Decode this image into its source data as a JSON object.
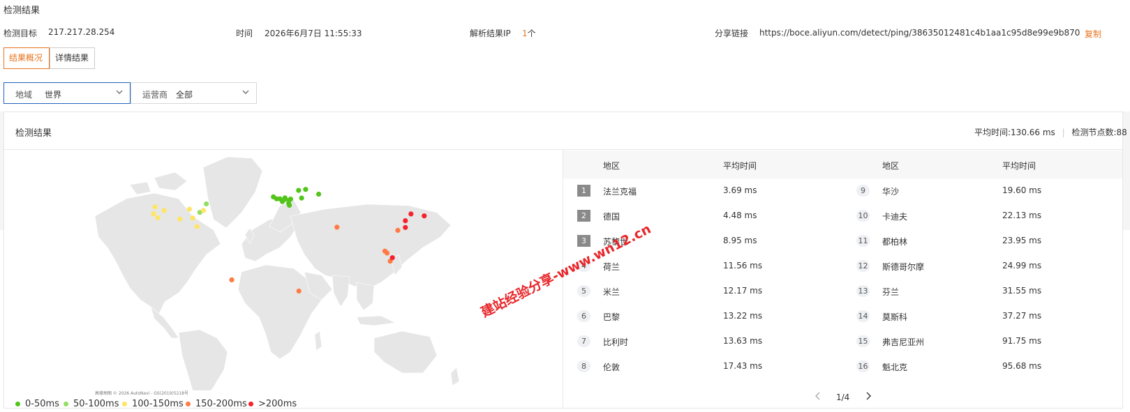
{
  "page": {
    "title": "检测结果"
  },
  "info": {
    "target_label": "检测目标",
    "target_value": "217.217.28.254",
    "time_label": "时间",
    "time_value": "2026年6月7日 11:55:33",
    "ip_label": "解析结果IP",
    "ip_count": "1",
    "ip_unit": "个",
    "share_label": "分享链接",
    "share_url": "https://boce.aliyun.com/detect/ping/38635012481c4b1aa1c95d8e99e9b870",
    "copy_label": "复制"
  },
  "tabs": [
    {
      "label": "结果概况",
      "active": true
    },
    {
      "label": "详情结果",
      "active": false
    }
  ],
  "filters": {
    "region": {
      "label": "地域",
      "value": "世界"
    },
    "isp": {
      "label": "运营商",
      "value": "全部"
    }
  },
  "results": {
    "title": "检测结果",
    "avg_label": "平均时间:",
    "avg_value": "130.66 ms",
    "nodes_label": "检测节点数:",
    "nodes_value": "88"
  },
  "table": {
    "col_region": "地区",
    "col_avg": "平均时间",
    "left_rows": [
      {
        "rank": "1",
        "region": "法兰克福",
        "time": "3.69 ms"
      },
      {
        "rank": "2",
        "region": "德国",
        "time": "4.48 ms"
      },
      {
        "rank": "3",
        "region": "苏黎世",
        "time": "8.95 ms"
      },
      {
        "rank": "4",
        "region": "荷兰",
        "time": "11.56 ms"
      },
      {
        "rank": "5",
        "region": "米兰",
        "time": "12.17 ms"
      },
      {
        "rank": "6",
        "region": "巴黎",
        "time": "13.22 ms"
      },
      {
        "rank": "7",
        "region": "比利时",
        "time": "13.63 ms"
      },
      {
        "rank": "8",
        "region": "伦敦",
        "time": "17.43 ms"
      }
    ],
    "right_rows": [
      {
        "rank": "9",
        "region": "华沙",
        "time": "19.60 ms"
      },
      {
        "rank": "10",
        "region": "卡迪夫",
        "time": "22.13 ms"
      },
      {
        "rank": "11",
        "region": "都柏林",
        "time": "23.95 ms"
      },
      {
        "rank": "12",
        "region": "斯德哥尔摩",
        "time": "24.99 ms"
      },
      {
        "rank": "13",
        "region": "芬兰",
        "time": "31.55 ms"
      },
      {
        "rank": "14",
        "region": "莫斯科",
        "time": "37.27 ms"
      },
      {
        "rank": "15",
        "region": "弗吉尼亚州",
        "time": "91.75 ms"
      },
      {
        "rank": "16",
        "region": "魁北克",
        "time": "95.68 ms"
      }
    ]
  },
  "pager": {
    "text": "1/4"
  },
  "legend": [
    {
      "label": "0-50ms",
      "color": "#52c41a"
    },
    {
      "label": "50-100ms",
      "color": "#95de64"
    },
    {
      "label": "100-150ms",
      "color": "#ffe566"
    },
    {
      "label": "150-200ms",
      "color": "#ff7a45"
    },
    {
      "label": ">200ms",
      "color": "#f5222d"
    }
  ],
  "map": {
    "attribution": "高德地图  © 2026 AutoNavi - GS(2019)5218号",
    "points": [
      {
        "lon": 8.7,
        "lat": 50.1,
        "level": 0
      },
      {
        "lon": 10.4,
        "lat": 51.2,
        "level": 0
      },
      {
        "lon": 8.5,
        "lat": 47.4,
        "level": 0
      },
      {
        "lon": 4.9,
        "lat": 52.4,
        "level": 0
      },
      {
        "lon": 9.2,
        "lat": 45.5,
        "level": 0
      },
      {
        "lon": 2.4,
        "lat": 48.9,
        "level": 0
      },
      {
        "lon": 4.4,
        "lat": 50.8,
        "level": 0
      },
      {
        "lon": -0.1,
        "lat": 51.5,
        "level": 0
      },
      {
        "lon": 21.0,
        "lat": 52.2,
        "level": 0
      },
      {
        "lon": -3.2,
        "lat": 51.5,
        "level": 0
      },
      {
        "lon": -6.3,
        "lat": 53.3,
        "level": 0
      },
      {
        "lon": 18.1,
        "lat": 59.3,
        "level": 0
      },
      {
        "lon": 24.9,
        "lat": 60.2,
        "level": 0
      },
      {
        "lon": 37.6,
        "lat": 55.8,
        "level": 0
      },
      {
        "lon": -77.5,
        "lat": 38.9,
        "level": 1
      },
      {
        "lon": -71.2,
        "lat": 46.8,
        "level": 1
      },
      {
        "lon": -122.3,
        "lat": 37.6,
        "level": 2
      },
      {
        "lon": -112.0,
        "lat": 40.7,
        "level": 2
      },
      {
        "lon": -87.6,
        "lat": 41.9,
        "level": 2
      },
      {
        "lon": -84.4,
        "lat": 33.7,
        "level": 2
      },
      {
        "lon": -96.8,
        "lat": 32.8,
        "level": 2
      },
      {
        "lon": -118.2,
        "lat": 34.0,
        "level": 2
      },
      {
        "lon": -80.2,
        "lat": 25.8,
        "level": 2
      },
      {
        "lon": -74.0,
        "lat": 40.7,
        "level": 2
      },
      {
        "lon": -121.0,
        "lat": 44.0,
        "level": 2
      },
      {
        "lon": -46.6,
        "lat": -23.5,
        "level": 3
      },
      {
        "lon": 18.4,
        "lat": -33.9,
        "level": 3
      },
      {
        "lon": 55.3,
        "lat": 25.2,
        "level": 3
      },
      {
        "lon": 103.8,
        "lat": 1.3,
        "level": 3
      },
      {
        "lon": 106.8,
        "lat": -6.2,
        "level": 3
      },
      {
        "lon": 101.7,
        "lat": 3.1,
        "level": 3
      },
      {
        "lon": 114.2,
        "lat": 22.3,
        "level": 3
      },
      {
        "lon": 121.5,
        "lat": 25.0,
        "level": 4
      },
      {
        "lon": 121.5,
        "lat": 31.2,
        "level": 4
      },
      {
        "lon": 126.9,
        "lat": 37.5,
        "level": 4
      },
      {
        "lon": 139.7,
        "lat": 35.7,
        "level": 4
      },
      {
        "lon": 108.9,
        "lat": -3.0,
        "level": 4
      }
    ]
  }
}
